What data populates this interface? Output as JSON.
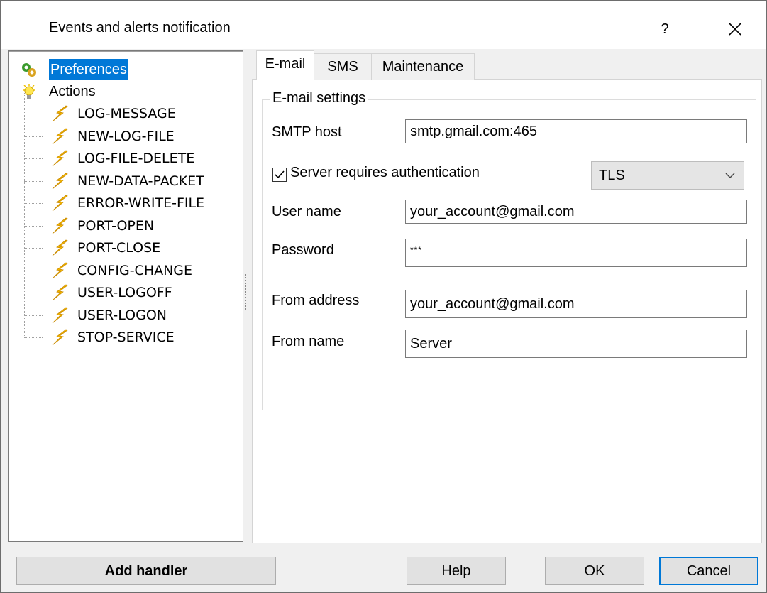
{
  "window": {
    "title": "Events and alerts notification",
    "help_glyph": "?",
    "close_glyph": "✕"
  },
  "tree": {
    "root_items": [
      {
        "label": "Preferences",
        "icon": "preferences-icon",
        "selected": true
      },
      {
        "label": "Actions",
        "icon": "lightbulb-icon",
        "selected": false
      }
    ],
    "actions": [
      "LOG-MESSAGE",
      "NEW-LOG-FILE",
      "LOG-FILE-DELETE",
      "NEW-DATA-PACKET",
      "ERROR-WRITE-FILE",
      "PORT-OPEN",
      "PORT-CLOSE",
      "CONFIG-CHANGE",
      "USER-LOGOFF",
      "USER-LOGON",
      "STOP-SERVICE"
    ]
  },
  "tabs": [
    {
      "label": "E-mail",
      "active": true
    },
    {
      "label": "SMS",
      "active": false
    },
    {
      "label": "Maintenance",
      "active": false
    }
  ],
  "email": {
    "group_title": "E-mail settings",
    "smtp_host_label": "SMTP host",
    "smtp_host_value": "smtp.gmail.com:465",
    "auth_checkbox_label": "Server requires authentication",
    "auth_checked": true,
    "security_value": "TLS",
    "username_label": "User name",
    "username_value": "your_account@gmail.com",
    "password_label": "Password",
    "password_value": "***",
    "from_address_label": "From address",
    "from_address_value": "your_account@gmail.com",
    "from_name_label": "From name",
    "from_name_value": "Server"
  },
  "buttons": {
    "add_handler": "Add handler",
    "help": "Help",
    "ok": "OK",
    "cancel": "Cancel"
  },
  "colors": {
    "selection": "#0078d7",
    "default_button_border": "#0078d7",
    "bolt": "#f5b800"
  }
}
